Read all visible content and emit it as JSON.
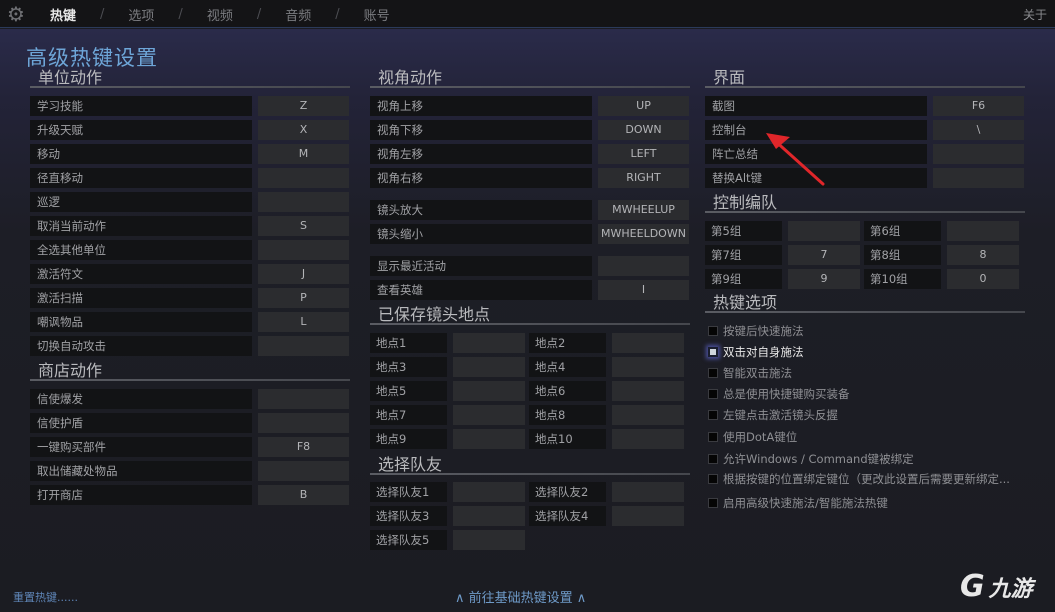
{
  "topbar": {
    "tabs": [
      "热键",
      "选项",
      "视频",
      "音频",
      "账号"
    ],
    "separator": "/",
    "about": "关于"
  },
  "page_title": "高级热键设置",
  "unit_actions": {
    "title": "单位动作",
    "rows": [
      {
        "label": "学习技能",
        "key": "Z"
      },
      {
        "label": "升级天赋",
        "key": "X"
      },
      {
        "label": "移动",
        "key": "M"
      },
      {
        "label": "径直移动",
        "key": ""
      },
      {
        "label": "巡逻",
        "key": ""
      },
      {
        "label": "取消当前动作",
        "key": "S"
      },
      {
        "label": "全选其他单位",
        "key": ""
      },
      {
        "label": "激活符文",
        "key": "J"
      },
      {
        "label": "激活扫描",
        "key": "P"
      },
      {
        "label": "嘲讽物品",
        "key": "L"
      },
      {
        "label": "切换自动攻击",
        "key": ""
      }
    ]
  },
  "shop_actions": {
    "title": "商店动作",
    "rows": [
      {
        "label": "信使爆发",
        "key": ""
      },
      {
        "label": "信使护盾",
        "key": ""
      },
      {
        "label": "一键购买部件",
        "key": "F8"
      },
      {
        "label": "取出储藏处物品",
        "key": ""
      },
      {
        "label": "打开商店",
        "key": "B"
      }
    ]
  },
  "camera_actions": {
    "title": "视角动作",
    "rows": [
      {
        "label": "视角上移",
        "key": "UP"
      },
      {
        "label": "视角下移",
        "key": "DOWN"
      },
      {
        "label": "视角左移",
        "key": "LEFT"
      },
      {
        "label": "视角右移",
        "key": "RIGHT"
      },
      {
        "label": "镜头放大",
        "key": "MWHEELUP"
      },
      {
        "label": "镜头缩小",
        "key": "MWHEELDOWN"
      },
      {
        "label": "显示最近活动",
        "key": ""
      },
      {
        "label": "查看英雄",
        "key": "I"
      }
    ]
  },
  "saved_camera": {
    "title": "已保存镜头地点",
    "pairs": [
      {
        "label": "地点1",
        "key": ""
      },
      {
        "label": "地点2",
        "key": ""
      },
      {
        "label": "地点3",
        "key": ""
      },
      {
        "label": "地点4",
        "key": ""
      },
      {
        "label": "地点5",
        "key": ""
      },
      {
        "label": "地点6",
        "key": ""
      },
      {
        "label": "地点7",
        "key": ""
      },
      {
        "label": "地点8",
        "key": ""
      },
      {
        "label": "地点9",
        "key": ""
      },
      {
        "label": "地点10",
        "key": ""
      }
    ]
  },
  "select_ally": {
    "title": "选择队友",
    "pairs": [
      {
        "label": "选择队友1",
        "key": ""
      },
      {
        "label": "选择队友2",
        "key": ""
      },
      {
        "label": "选择队友3",
        "key": ""
      },
      {
        "label": "选择队友4",
        "key": ""
      },
      {
        "label": "选择队友5",
        "key": ""
      }
    ]
  },
  "interface": {
    "title": "界面",
    "rows": [
      {
        "label": "截图",
        "key": "F6"
      },
      {
        "label": "控制台",
        "key": "\\"
      },
      {
        "label": "阵亡总结",
        "key": ""
      },
      {
        "label": "替换Alt键",
        "key": ""
      }
    ]
  },
  "control_groups": {
    "title": "控制编队",
    "pairs": [
      {
        "label": "第5组",
        "key": ""
      },
      {
        "label": "第6组",
        "key": ""
      },
      {
        "label": "第7组",
        "key": "7"
      },
      {
        "label": "第8组",
        "key": "8"
      },
      {
        "label": "第9组",
        "key": "9"
      },
      {
        "label": "第10组",
        "key": "0"
      }
    ]
  },
  "hotkey_options": {
    "title": "热键选项",
    "options": [
      {
        "label": "按键后快速施法",
        "checked": false
      },
      {
        "label": "双击对自身施法",
        "checked": false,
        "focused": true
      },
      {
        "label": "智能双击施法",
        "checked": false
      },
      {
        "label": "总是使用快捷键购买装备",
        "checked": false
      },
      {
        "label": "左键点击激活镜头反握",
        "checked": false
      },
      {
        "label": "使用DotA键位",
        "checked": false
      },
      {
        "label": "允许Windows / Command键被绑定",
        "checked": false
      },
      {
        "label": "根据按键的位置绑定键位（更改此设置后需要更新绑定...",
        "checked": false
      },
      {
        "label": "启用高级快速施法/智能施法热键",
        "checked": false
      }
    ]
  },
  "footer": {
    "reset": "重置热键......",
    "goto_basic": "∧ 前往基础热键设置 ∧",
    "watermark": "九游"
  },
  "colors": {
    "accent": "#6ea6d8",
    "annotation_arrow": "#e0262a"
  }
}
